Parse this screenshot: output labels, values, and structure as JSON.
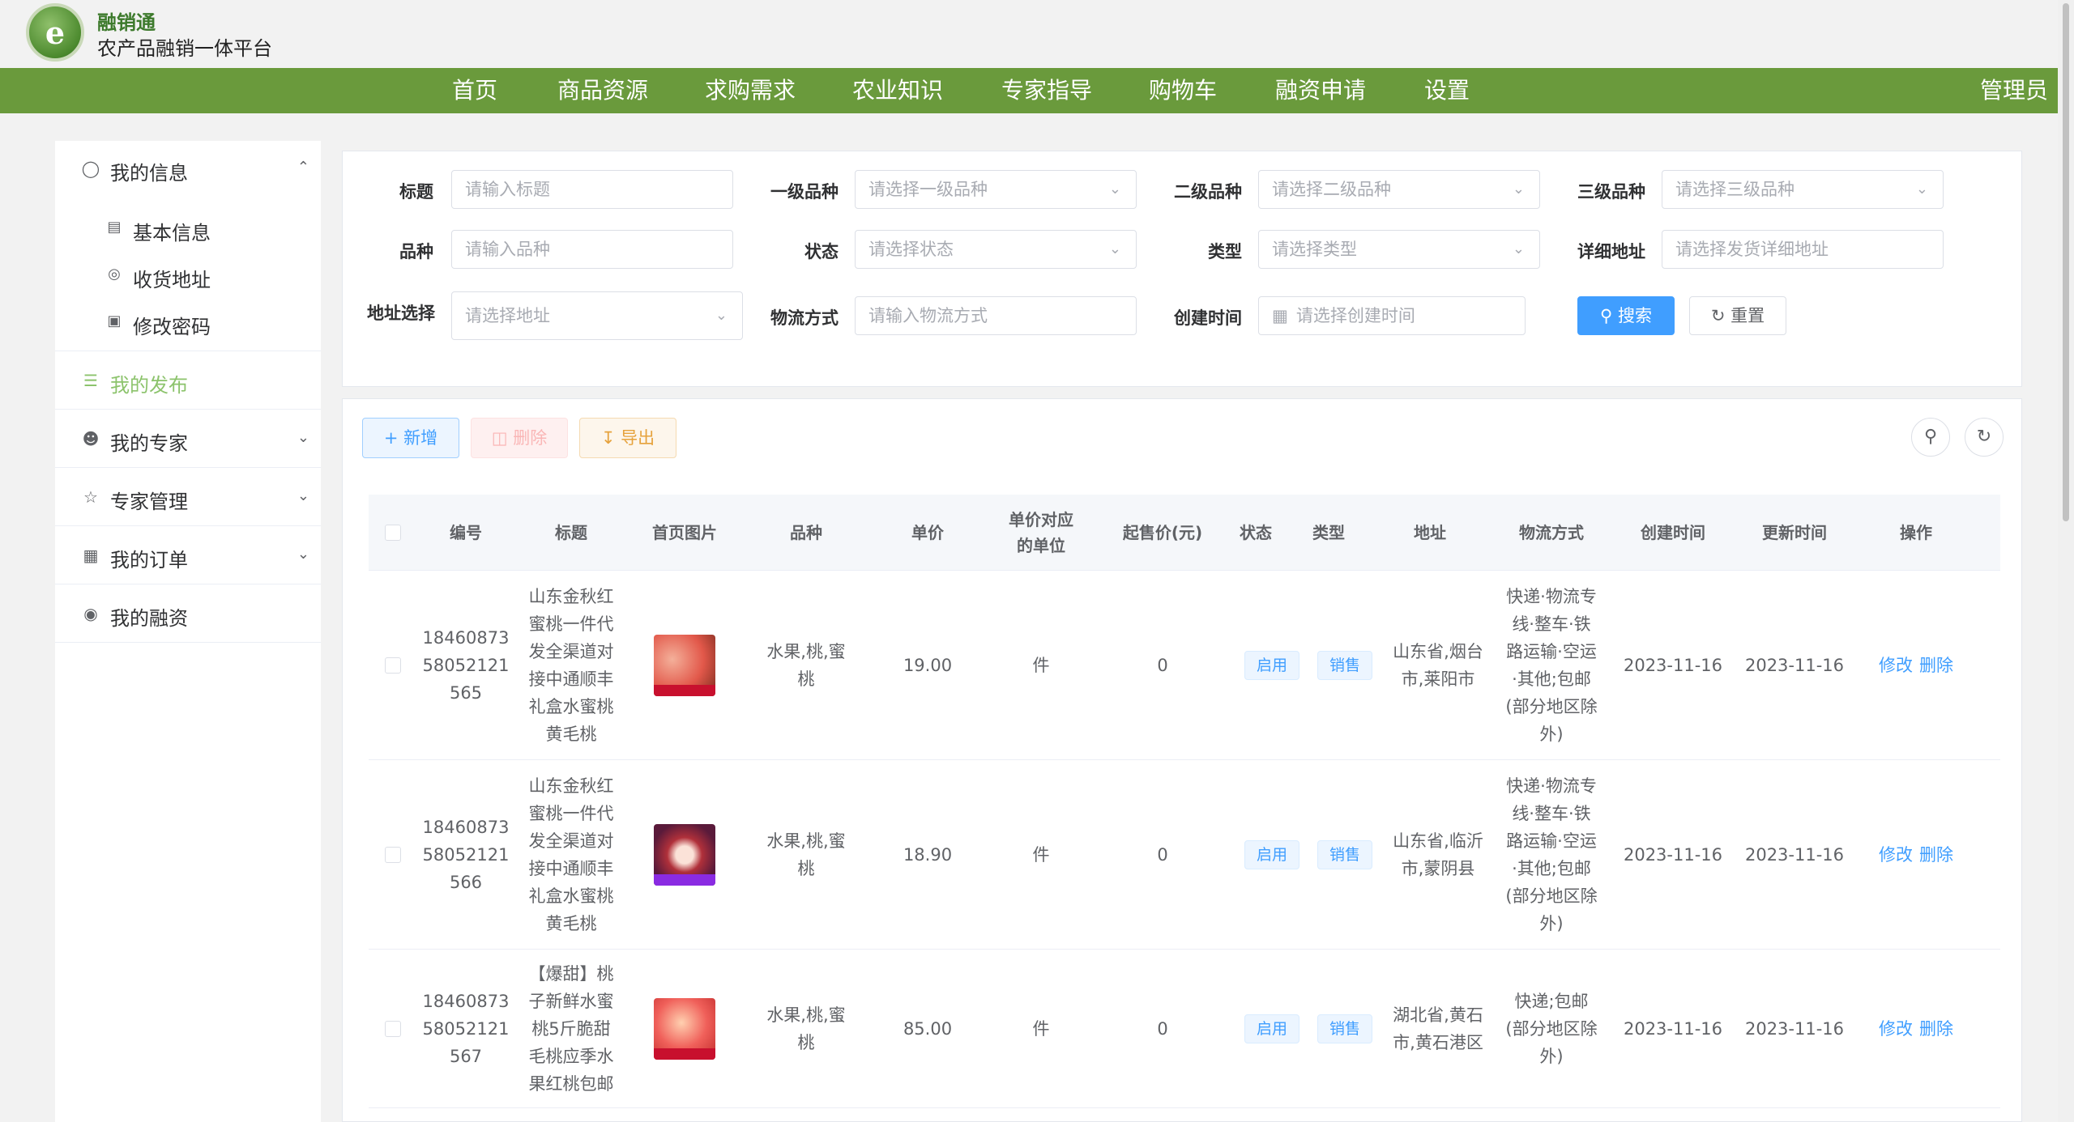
{
  "brand": {
    "logo_letter": "e",
    "name": "融销通",
    "subtitle": "农产品融销一体平台"
  },
  "nav": {
    "items": [
      "首页",
      "商品资源",
      "求购需求",
      "农业知识",
      "专家指导",
      "购物车",
      "融资申请",
      "设置"
    ],
    "user": "管理员"
  },
  "sidebar": {
    "my_info": "我的信息",
    "sub": [
      "基本信息",
      "收货地址",
      "修改密码"
    ],
    "my_publish": "我的发布",
    "my_expert": "我的专家",
    "expert_manage": "专家管理",
    "my_orders": "我的订单",
    "my_financing": "我的融资"
  },
  "search": {
    "title_label": "标题",
    "title_placeholder": "请输入标题",
    "cat1_label": "一级品种",
    "cat1_placeholder": "请选择一级品种",
    "cat2_label": "二级品种",
    "cat2_placeholder": "请选择二级品种",
    "cat3_label": "三级品种",
    "cat3_placeholder": "请选择三级品种",
    "variety_label": "品种",
    "variety_placeholder": "请输入品种",
    "status_label": "状态",
    "status_placeholder": "请选择状态",
    "type_label": "类型",
    "type_placeholder": "请选择类型",
    "address_label": "详细地址",
    "address_placeholder": "请选择发货详细地址",
    "region_label": "地址选择",
    "region_placeholder": "请选择地址",
    "logistics_label": "物流方式",
    "logistics_placeholder": "请输入物流方式",
    "created_label": "创建时间",
    "created_placeholder": "请选择创建时间",
    "search_btn": "搜索",
    "reset_btn": "重置"
  },
  "toolbar": {
    "add": "新增",
    "delete": "删除",
    "export": "导出"
  },
  "table": {
    "headers": [
      "编号",
      "标题",
      "首页图片",
      "品种",
      "单价",
      "单价对应的单位",
      "起售价(元)",
      "状态",
      "类型",
      "地址",
      "物流方式",
      "创建时间",
      "更新时间",
      "操作"
    ],
    "rows": [
      {
        "id": "1846087358052121565",
        "title": "山东金秋红蜜桃一件代发全渠道对接中通顺丰礼盒水蜜桃黄毛桃",
        "variety": "水果,桃,蜜桃",
        "price": "19.00",
        "unit": "件",
        "min_price": "0",
        "status": "启用",
        "type": "销售",
        "address": "山东省,烟台市,莱阳市",
        "logistics": "快递·物流专线·整车·铁路运输·空运·其他;包邮(部分地区除外)",
        "created": "2023-11-16",
        "updated": "2023-11-16",
        "edit": "修改",
        "del": "删除"
      },
      {
        "id": "1846087358052121566",
        "title": "山东金秋红蜜桃一件代发全渠道对接中通顺丰礼盒水蜜桃黄毛桃",
        "variety": "水果,桃,蜜桃",
        "price": "18.90",
        "unit": "件",
        "min_price": "0",
        "status": "启用",
        "type": "销售",
        "address": "山东省,临沂市,蒙阴县",
        "logistics": "快递·物流专线·整车·铁路运输·空运·其他;包邮(部分地区除外)",
        "created": "2023-11-16",
        "updated": "2023-11-16",
        "edit": "修改",
        "del": "删除"
      },
      {
        "id": "1846087358052121567",
        "title": "【爆甜】桃子新鲜水蜜桃5斤脆甜毛桃应季水果红桃包邮",
        "variety": "水果,桃,蜜桃",
        "price": "85.00",
        "unit": "件",
        "min_price": "0",
        "status": "启用",
        "type": "销售",
        "address": "湖北省,黄石市,黄石港区",
        "logistics": "快递;包邮(部分地区除外)",
        "created": "2023-11-16",
        "updated": "2023-11-16",
        "edit": "修改",
        "del": "删除"
      }
    ]
  },
  "colors": {
    "nav_green": "#6a9a3c",
    "primary": "#409eff",
    "active_green": "#8cc36c"
  }
}
